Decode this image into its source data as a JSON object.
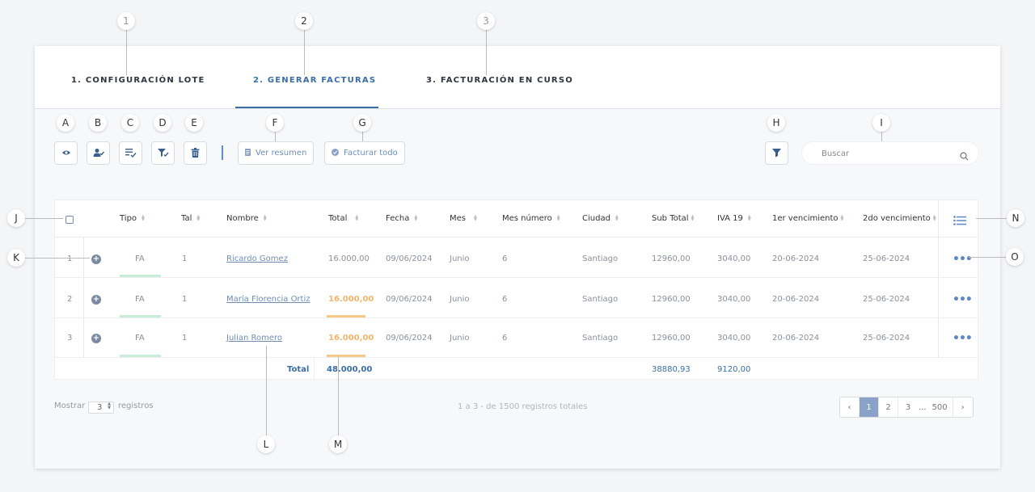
{
  "steps": [
    "1",
    "2",
    "3"
  ],
  "tabs": [
    {
      "label": "1. CONFIGURACIÓN LOTE"
    },
    {
      "label": "2. GENERAR FACTURAS"
    },
    {
      "label": "3. FACTURACIÓN EN CURSO"
    }
  ],
  "active_tab": 1,
  "callouts": [
    "A",
    "B",
    "C",
    "D",
    "E",
    "F",
    "G",
    "H",
    "I",
    "J",
    "K",
    "L",
    "M",
    "N",
    "O"
  ],
  "toolbar": {
    "icons": [
      "eye-icon",
      "user-check-icon",
      "list-check-icon",
      "filter-check-icon",
      "trash-icon"
    ],
    "ver_resumen": "Ver resumen",
    "facturar_todo": "Facturar todo",
    "filter_icon": "filter-icon"
  },
  "search": {
    "placeholder": "Buscar",
    "icon": "search-icon"
  },
  "table": {
    "headers": [
      "Tipo",
      "Tal",
      "Nombre",
      "Total",
      "Fecha",
      "Mes",
      "Mes número",
      "Ciudad",
      "Sub Total",
      "IVA 19",
      "1er vencimiento",
      "2do vencimiento"
    ],
    "rows": [
      {
        "num": "1",
        "tipo": "FA",
        "tal": "1",
        "nombre": "Ricardo Gomez",
        "total": "16.000,00",
        "fecha": "09/06/2024",
        "mes": "Junio",
        "mes_numero": "6",
        "ciudad": "Santiago",
        "sub_total": "12960,00",
        "iva": "3040,00",
        "venc1": "20-06-2024",
        "venc2": "25-06-2024"
      },
      {
        "num": "2",
        "tipo": "FA",
        "tal": "1",
        "nombre": "María Florencia Ortiz",
        "total": "16.000,00",
        "fecha": "09/06/2024",
        "mes": "Junio",
        "mes_numero": "6",
        "ciudad": "Santiago",
        "sub_total": "12960,00",
        "iva": "3040,00",
        "venc1": "20-06-2024",
        "venc2": "25-06-2024"
      },
      {
        "num": "3",
        "tipo": "FA",
        "tal": "1",
        "nombre": "Julian Romero",
        "total": "16.000,00",
        "fecha": "09/06/2024",
        "mes": "Junio",
        "mes_numero": "6",
        "ciudad": "Santiago",
        "sub_total": "12960,00",
        "iva": "3040,00",
        "venc1": "20-06-2024",
        "venc2": "25-06-2024"
      }
    ],
    "totals": {
      "label": "Total",
      "total": "48.000,00",
      "sub_total": "38880,93",
      "iva": "9120,00"
    }
  },
  "footer": {
    "mostrar": "Mostrar",
    "per_page": "3",
    "registros": "registros",
    "info": "1 a 3 - de 1500 registros totales",
    "pages": [
      "1",
      "2",
      "3",
      "...",
      "500"
    ],
    "current_page": "1"
  },
  "colors": {
    "accent": "#3a6ea5",
    "link": "#6f8db5",
    "highlight": "#f5b46a",
    "tipo_underline": "#c8ecd5"
  }
}
